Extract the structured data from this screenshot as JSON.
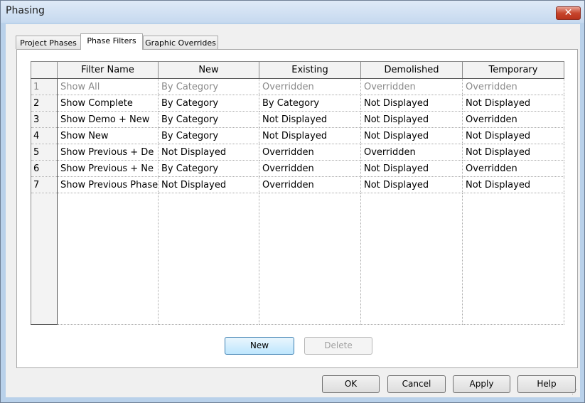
{
  "window": {
    "title": "Phasing"
  },
  "tabs": [
    {
      "label": "Project Phases",
      "active": false
    },
    {
      "label": "Phase Filters",
      "active": true
    },
    {
      "label": "Graphic Overrides",
      "active": false
    }
  ],
  "grid": {
    "columns": [
      "Filter Name",
      "New",
      "Existing",
      "Demolished",
      "Temporary"
    ],
    "rows": [
      {
        "num": "1",
        "name": "Show All",
        "new": "By Category",
        "existing": "Overridden",
        "demolished": "Overridden",
        "temporary": "Overridden"
      },
      {
        "num": "2",
        "name": "Show Complete",
        "new": "By Category",
        "existing": "By Category",
        "demolished": "Not Displayed",
        "temporary": "Not Displayed"
      },
      {
        "num": "3",
        "name": "Show Demo + New",
        "new": "By Category",
        "existing": "Not Displayed",
        "demolished": "Not Displayed",
        "temporary": "Overridden"
      },
      {
        "num": "4",
        "name": "Show New",
        "new": "By Category",
        "existing": "Not Displayed",
        "demolished": "Not Displayed",
        "temporary": "Not Displayed"
      },
      {
        "num": "5",
        "name": "Show Previous + De",
        "new": "Not Displayed",
        "existing": "Overridden",
        "demolished": "Overridden",
        "temporary": "Not Displayed"
      },
      {
        "num": "6",
        "name": "Show Previous + Ne",
        "new": "By Category",
        "existing": "Overridden",
        "demolished": "Not Displayed",
        "temporary": "Overridden"
      },
      {
        "num": "7",
        "name": "Show Previous Phase",
        "new": "Not Displayed",
        "existing": "Overridden",
        "demolished": "Not Displayed",
        "temporary": "Not Displayed"
      }
    ]
  },
  "panel_buttons": {
    "new": "New",
    "delete": "Delete"
  },
  "footer_buttons": {
    "ok": "OK",
    "cancel": "Cancel",
    "apply": "Apply",
    "help": "Help"
  },
  "icons": {
    "close": "close-icon",
    "resize_grip": "resize-grip-icon"
  },
  "colors": {
    "titlebar": "#c6d9ef",
    "close_button": "#c7452c",
    "primary_button": "#bee6fd",
    "dim_text": "#8a8a8a"
  }
}
